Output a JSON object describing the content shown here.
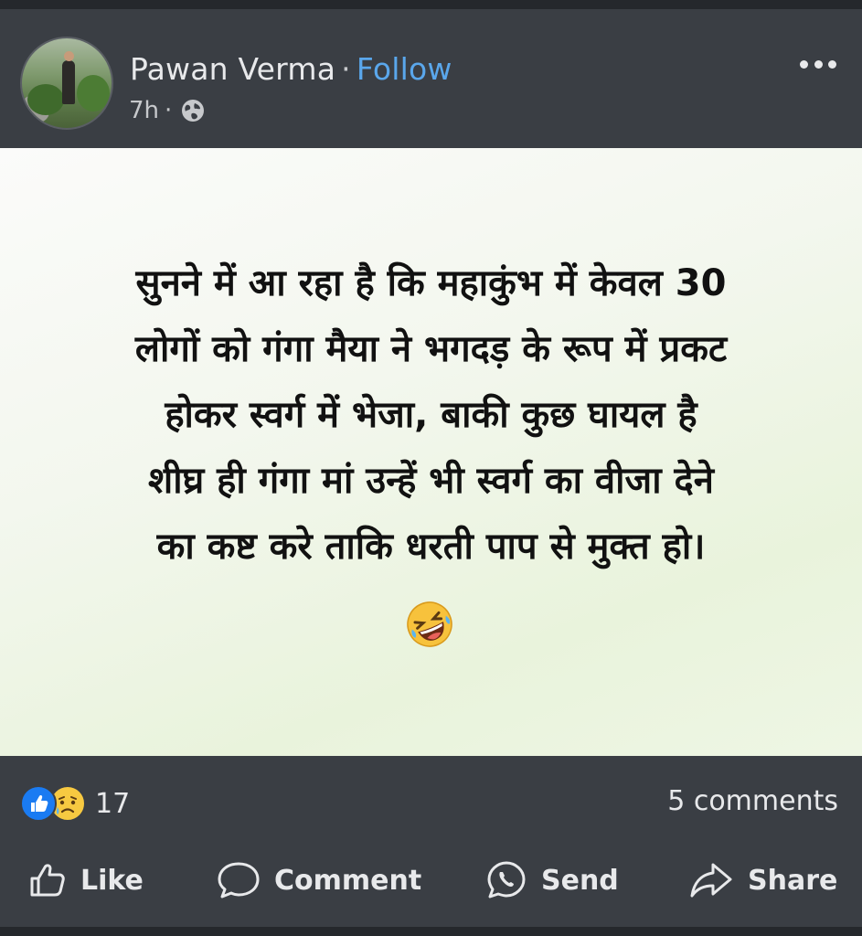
{
  "header": {
    "author_name": "Pawan Verma",
    "separator": "·",
    "follow_label": "Follow",
    "time": "7h",
    "time_separator": "·",
    "privacy_icon": "globe-icon",
    "more_icon": "more-dots-icon"
  },
  "post": {
    "lines": [
      "सुनने में आ रहा है कि महाकुंभ में  केवल 30",
      "लोगों को गंगा मैया ने भगदड़ के रूप में प्रकट",
      "होकर स्वर्ग में भेजा,  बाकी कुछ घायल है",
      "शीघ्र ही गंगा मां उन्हें भी स्वर्ग का वीजा देने",
      "का कष्ट करे ताकि धरती पाप से मुक्त हो।"
    ],
    "emoji": "rolling-on-floor-laughing-emoji"
  },
  "footer": {
    "reactions": [
      "like-reaction-icon",
      "sad-reaction-icon"
    ],
    "reaction_count": "17",
    "comments_count": "5 comments",
    "actions": {
      "like": "Like",
      "comment": "Comment",
      "send": "Send",
      "share": "Share"
    }
  },
  "colors": {
    "background": "#3a3e44",
    "follow": "#5aa7ec",
    "like_reaction": "#1a7bf2",
    "sad_reaction": "#f7c941"
  }
}
